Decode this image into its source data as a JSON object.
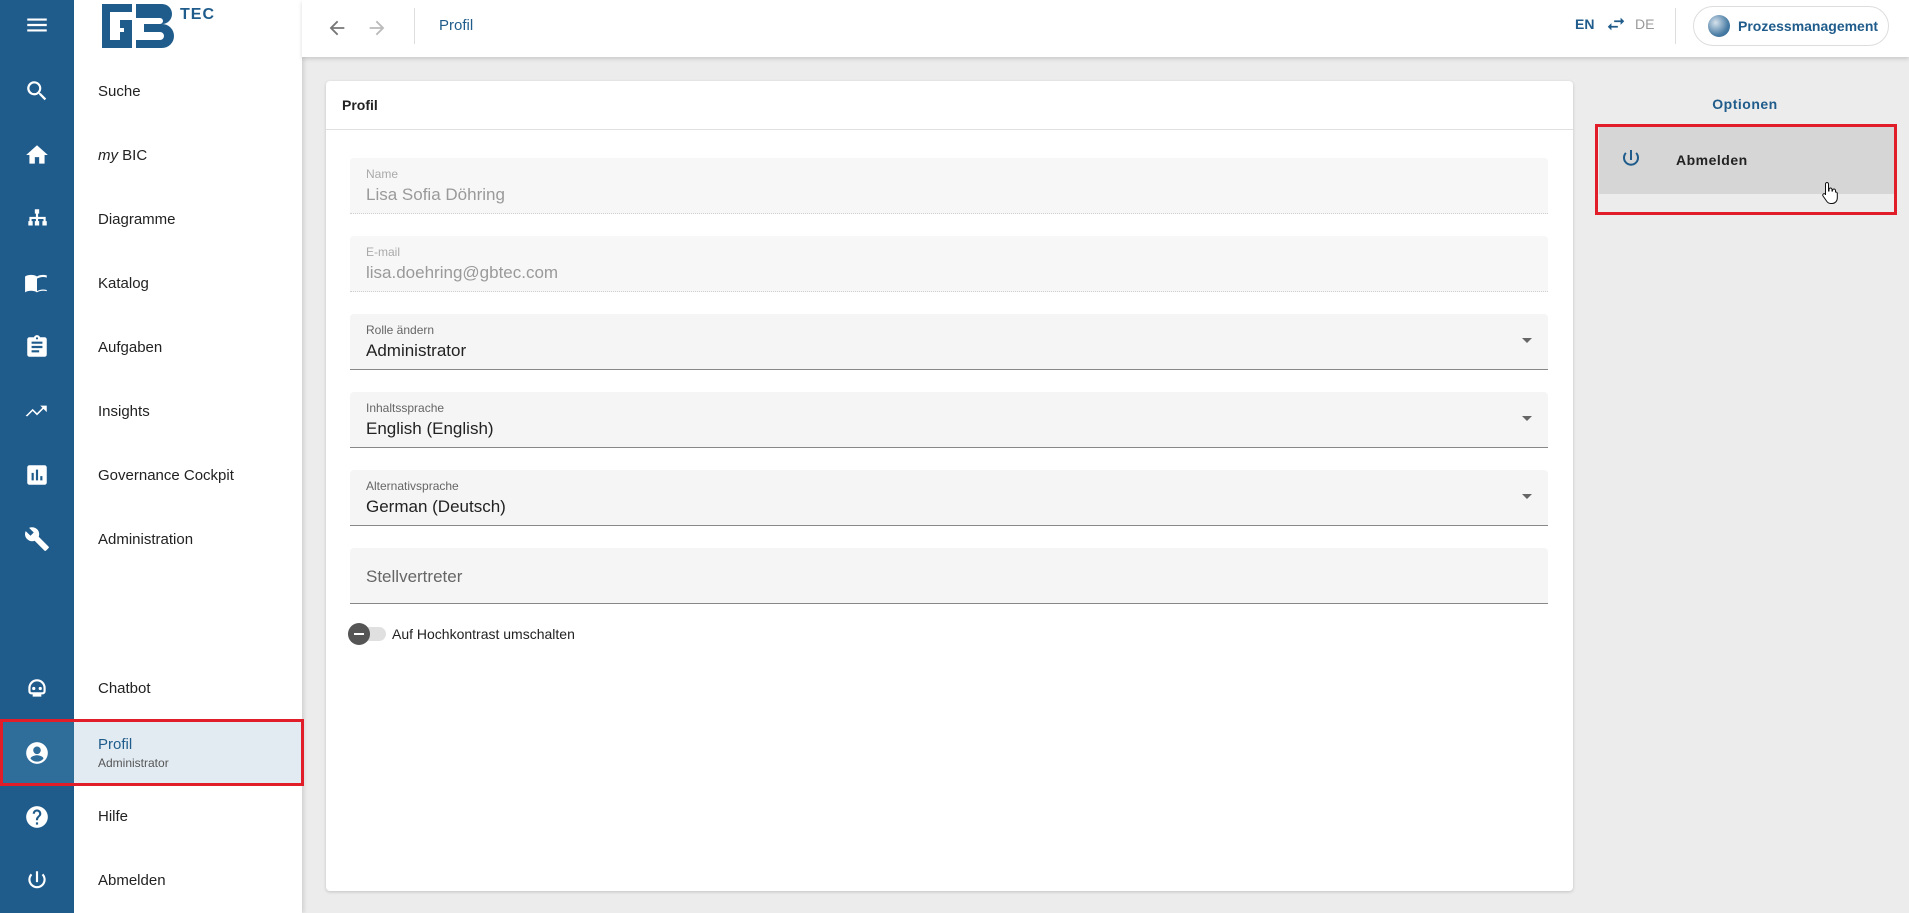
{
  "rail": {
    "icons": [
      "menu-icon",
      "search-icon",
      "home-icon",
      "sitemap-icon",
      "book-icon",
      "clipboard-icon",
      "insights-icon",
      "chart-icon",
      "wrench-icon",
      "chatbot-icon",
      "account-icon",
      "help-icon",
      "power-icon"
    ]
  },
  "logo": {
    "text": "TEC"
  },
  "nav": {
    "search": "Suche",
    "mybic_my": "my",
    "mybic_bic": " BIC",
    "diagrams": "Diagramme",
    "catalog": "Katalog",
    "tasks": "Aufgaben",
    "insights": "Insights",
    "governance": "Governance Cockpit",
    "administration": "Administration",
    "chatbot": "Chatbot",
    "profile": "Profil",
    "profile_sub": "Administrator",
    "help": "Hilfe",
    "logout": "Abmelden"
  },
  "topbar": {
    "breadcrumb": "Profil",
    "lang_active": "EN",
    "lang_other": "DE",
    "app_switch": "Prozessmanagement"
  },
  "card": {
    "title": "Profil",
    "fields": {
      "name_label": "Name",
      "name_value": "Lisa Sofia Döhring",
      "email_label": "E-mail",
      "email_value": "lisa.doehring@gbtec.com",
      "role_label": "Rolle ändern",
      "role_value": "Administrator",
      "content_lang_label": "Inhaltssprache",
      "content_lang_value": "English (English)",
      "alt_lang_label": "Alternativsprache",
      "alt_lang_value": "German (Deutsch)",
      "deputy_placeholder": "Stellvertreter"
    },
    "toggle_label": "Auf Hochkontrast umschalten"
  },
  "options": {
    "title": "Optionen",
    "logout": "Abmelden"
  },
  "colors": {
    "brand": "#1f5c8b",
    "highlight": "#e11d2a"
  }
}
